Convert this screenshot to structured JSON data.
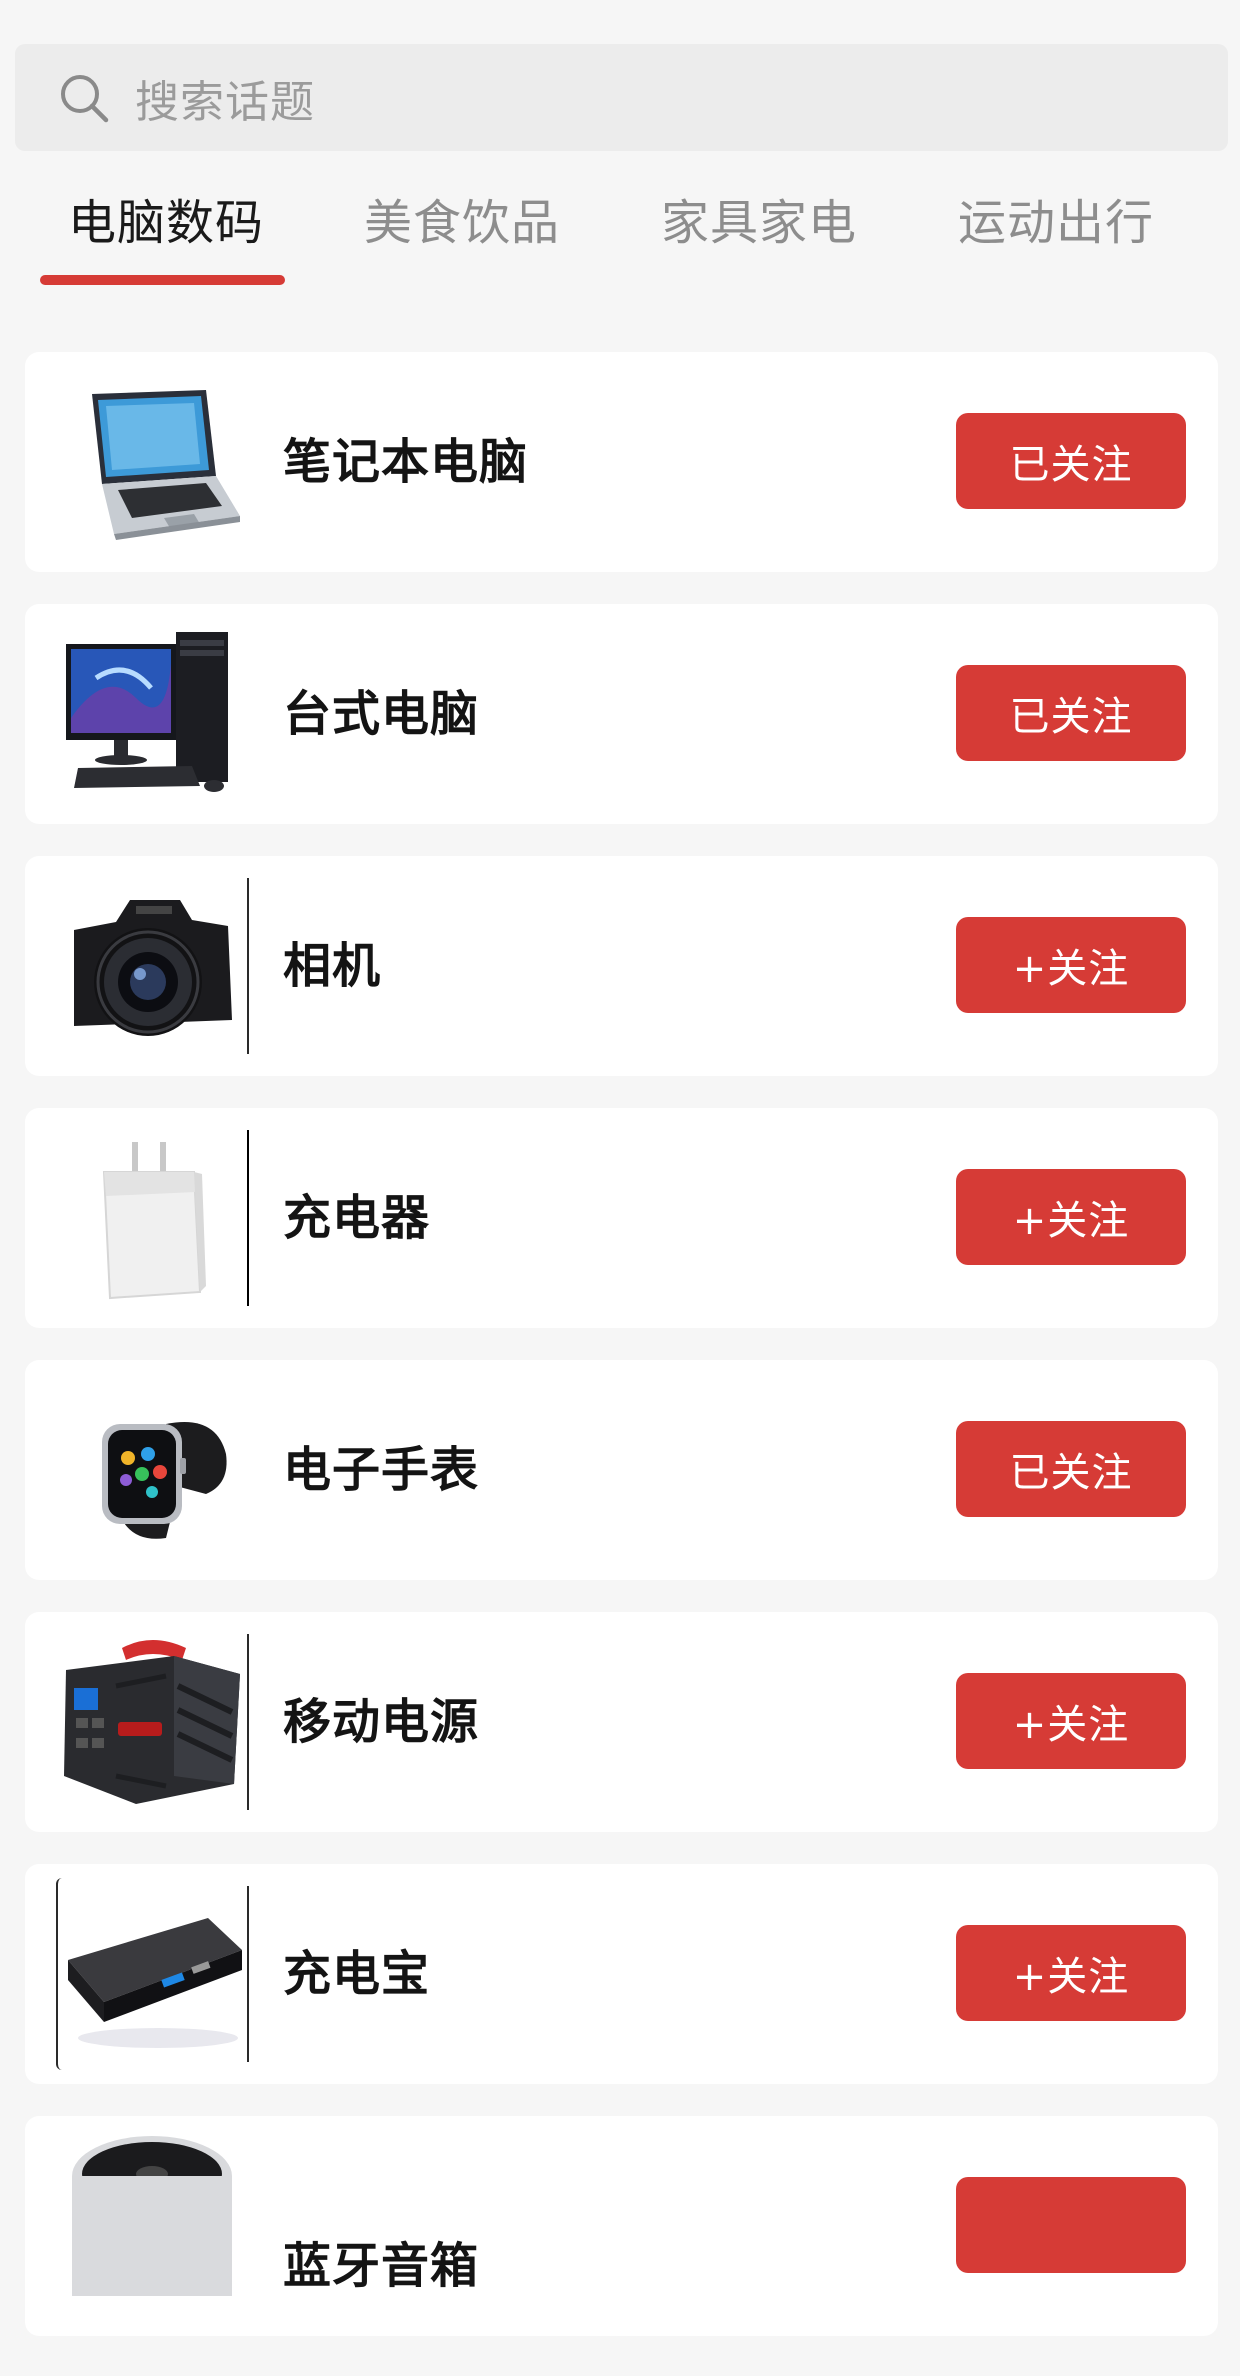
{
  "search": {
    "placeholder": "搜索话题",
    "icon": "search-icon"
  },
  "tabs": [
    {
      "label": "电脑数码",
      "active": true
    },
    {
      "label": "美食饮品",
      "active": false
    },
    {
      "label": "家具家电",
      "active": false
    },
    {
      "label": "运动出行",
      "active": false
    }
  ],
  "items": [
    {
      "title": "笔记本电脑",
      "button": "已关注",
      "image": "laptop-image"
    },
    {
      "title": "台式电脑",
      "button": "已关注",
      "image": "desktop-computer-image"
    },
    {
      "title": "相机",
      "button": "+关注",
      "image": "camera-image"
    },
    {
      "title": "充电器",
      "button": "+关注",
      "image": "charger-image"
    },
    {
      "title": "电子手表",
      "button": "已关注",
      "image": "smartwatch-image"
    },
    {
      "title": "移动电源",
      "button": "+关注",
      "image": "portable-power-station-image"
    },
    {
      "title": "充电宝",
      "button": "+关注",
      "image": "power-bank-image"
    },
    {
      "title": "蓝牙音箱",
      "button": "",
      "image": "speaker-image"
    }
  ],
  "colors": {
    "accent": "#d63b36",
    "background": "#f6f6f6",
    "card": "#ffffff",
    "tab_inactive": "#8d8d8d"
  }
}
